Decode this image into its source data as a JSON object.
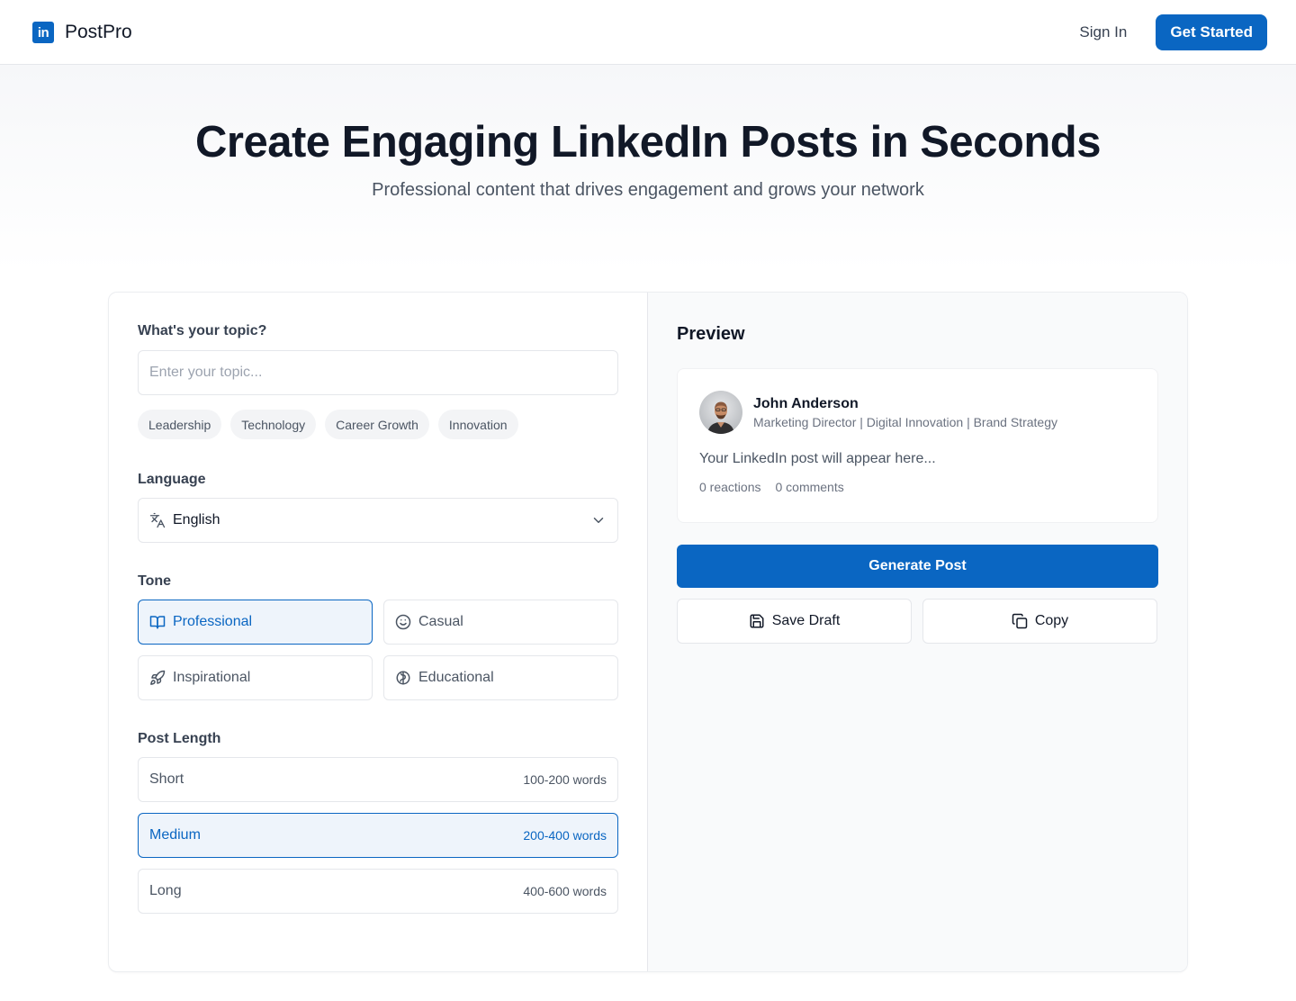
{
  "header": {
    "logo_text": "in",
    "brand_name": "PostPro",
    "sign_in_label": "Sign In",
    "get_started_label": "Get Started"
  },
  "hero": {
    "title": "Create Engaging LinkedIn Posts in Seconds",
    "subtitle": "Professional content that drives engagement and grows your network"
  },
  "form": {
    "topic_label": "What's your topic?",
    "topic_value": "",
    "topic_placeholder": "Enter your topic...",
    "topic_chips": [
      "Leadership",
      "Technology",
      "Career Growth",
      "Innovation"
    ],
    "language_label": "Language",
    "language_value": "English",
    "tone_label": "Tone",
    "tones": [
      {
        "label": "Professional",
        "icon": "book-open-icon",
        "selected": true
      },
      {
        "label": "Casual",
        "icon": "smile-icon",
        "selected": false
      },
      {
        "label": "Inspirational",
        "icon": "rocket-icon",
        "selected": false
      },
      {
        "label": "Educational",
        "icon": "brain-icon",
        "selected": false
      }
    ],
    "length_label": "Post Length",
    "lengths": [
      {
        "label": "Short",
        "words": "100-200 words",
        "selected": false
      },
      {
        "label": "Medium",
        "words": "200-400 words",
        "selected": true
      },
      {
        "label": "Long",
        "words": "400-600 words",
        "selected": false
      }
    ]
  },
  "preview": {
    "title": "Preview",
    "author_name": "John Anderson",
    "author_title": "Marketing Director | Digital Innovation | Brand Strategy",
    "body": "Your LinkedIn post will appear here...",
    "reactions": "0 reactions",
    "comments": "0 comments",
    "generate_label": "Generate Post",
    "save_draft_label": "Save Draft",
    "copy_label": "Copy"
  },
  "colors": {
    "accent": "#0a66c2",
    "accent_light": "#eef4fb",
    "border": "#e5e7eb",
    "text_primary": "#111827",
    "text_secondary": "#4b5563"
  }
}
